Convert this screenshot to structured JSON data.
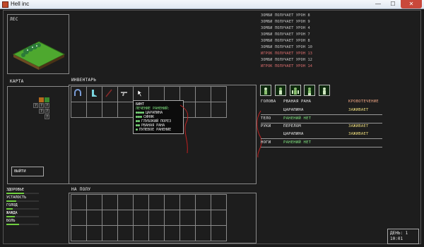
{
  "window": {
    "title": "Hell inc",
    "min": "—",
    "max": "☐",
    "close": "✕"
  },
  "scene": {
    "label": "ЛЕС"
  },
  "map": {
    "label": "КАРТА",
    "unknown_mark": "?",
    "exit_label": "ВЫЙТИ"
  },
  "inventory": {
    "label": "ИНВЕНТАРЬ",
    "items": [
      {
        "icon": "magnet-icon",
        "color": "#7a9cd6"
      },
      {
        "icon": "boots-icon",
        "color": "#7ad6e0"
      },
      {
        "icon": "rod-icon",
        "color": "#8a2a2a"
      },
      {
        "icon": "pistol-icon",
        "color": "#a8a8a8"
      }
    ],
    "tooltip": {
      "title": "БИНТ",
      "subtitle": "ЛЕЧЕНИЕ РАНЕНИЙ:",
      "lines": [
        {
          "dots": "●●●●",
          "text": "ЦАРАПИНА"
        },
        {
          "dots": "●●●",
          "text": "СИНЯК"
        },
        {
          "dots": "●●",
          "text": "ГЛУБОКИЙ ПОРЕЗ"
        },
        {
          "dots": "●●",
          "text": "РВАНАЯ РАНА"
        },
        {
          "dots": "●",
          "text": "ПУЛЕВОЕ РАНЕНИЕ"
        }
      ]
    }
  },
  "floor": {
    "label": "НА ПОЛУ"
  },
  "log": [
    {
      "text": "ЗОМБИ ПОЛУЧАЕТ УРОН 8",
      "color": "#c8c8c8"
    },
    {
      "text": "ЗОМБИ ПОЛУЧАЕТ УРОН 9",
      "color": "#c8c8c8"
    },
    {
      "text": "ЗОМБИ ПОЛУЧАЕТ УРОН 4",
      "color": "#c8c8c8"
    },
    {
      "text": "ЗОМБИ ПОЛУЧАЕТ УРОН 7",
      "color": "#c8c8c8"
    },
    {
      "text": "ЗОМБИ ПОЛУЧАЕТ УРОН 8",
      "color": "#c8c8c8"
    },
    {
      "text": "ЗОМБИ ПОЛУЧАЕТ УРОН 10",
      "color": "#c8c8c8"
    },
    {
      "text": "ИГРОК ПОЛУЧАЕТ УРОН 13",
      "color": "#e07070"
    },
    {
      "text": "ЗОМБИ ПОЛУЧАЕТ УРОН 12",
      "color": "#c8c8c8"
    },
    {
      "text": "ИГРОК ПОЛУЧАЕТ УРОН 14",
      "color": "#e07070"
    }
  ],
  "body": {
    "rows": [
      {
        "part": "ГОЛОВА",
        "injury": "РВАНАЯ РАНА",
        "status": "КРОВОТЕЧЕНИЕ",
        "status_color": "#e8a080"
      },
      {
        "part": "",
        "injury": "ЦАРАПИНА",
        "status": "ЗАЖИВАЕТ",
        "status_color": "#e8d87a"
      },
      {
        "part": "ТЕЛО",
        "injury": "РАНЕНИЙ НЕТ",
        "status": "",
        "status_color": "#7ee07e"
      },
      {
        "part": "РУКИ",
        "injury": "ПЕРЕЛОМ",
        "status": "ЗАЖИВАЕТ",
        "status_color": "#e8d87a"
      },
      {
        "part": "",
        "injury": "ЦАРАПИНА",
        "status": "ЗАЖИВАЕТ",
        "status_color": "#e8d87a"
      },
      {
        "part": "НОГИ",
        "injury": "РАНЕНИЙ НЕТ",
        "status": "",
        "status_color": "#7ee07e"
      }
    ]
  },
  "stats": [
    {
      "label": "ЗДОРОВЬЕ",
      "fill": 0.55,
      "color": "#6fcf3f"
    },
    {
      "label": "УСТАЛОСТЬ",
      "fill": 0.3,
      "color": "#6fcf3f"
    },
    {
      "label": "ГОЛОД",
      "fill": 0.2,
      "color": "#6fcf3f"
    },
    {
      "label": "ЖАЖДА",
      "fill": 0.25,
      "color": "#6fcf3f"
    },
    {
      "label": "БОЛЬ",
      "fill": 0.4,
      "color": "#6fcf3f"
    }
  ],
  "clock": {
    "day": "ДЕНЬ: 1",
    "time": "10:01"
  }
}
